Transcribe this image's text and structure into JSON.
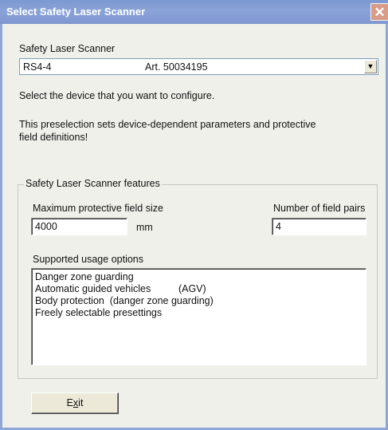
{
  "window": {
    "title": "Select Safety Laser Scanner",
    "close_symbol": "✕"
  },
  "scanner": {
    "label": "Safety Laser Scanner",
    "selected_model": "RS4-4",
    "selected_article": "Art. 50034195",
    "dropdown_arrow": "▼"
  },
  "info": {
    "line1": "Select the device that you want to configure.",
    "line2a": "This preselection sets device-dependent parameters and protective",
    "line2b": "field definitions!"
  },
  "features": {
    "legend": "Safety Laser Scanner features",
    "max_field_label": "Maximum protective field size",
    "max_field_value": "4000",
    "max_field_unit": "mm",
    "field_pairs_label": "Number of field pairs",
    "field_pairs_value": "4",
    "usage_label": "Supported usage options",
    "usage_options": [
      "Danger zone guarding",
      "Automatic guided vehicles          (AGV)",
      "Body protection  (danger zone guarding)",
      "Freely selectable presettings"
    ]
  },
  "buttons": {
    "exit_prefix": "E",
    "exit_mnemonic": "x",
    "exit_suffix": "it"
  }
}
